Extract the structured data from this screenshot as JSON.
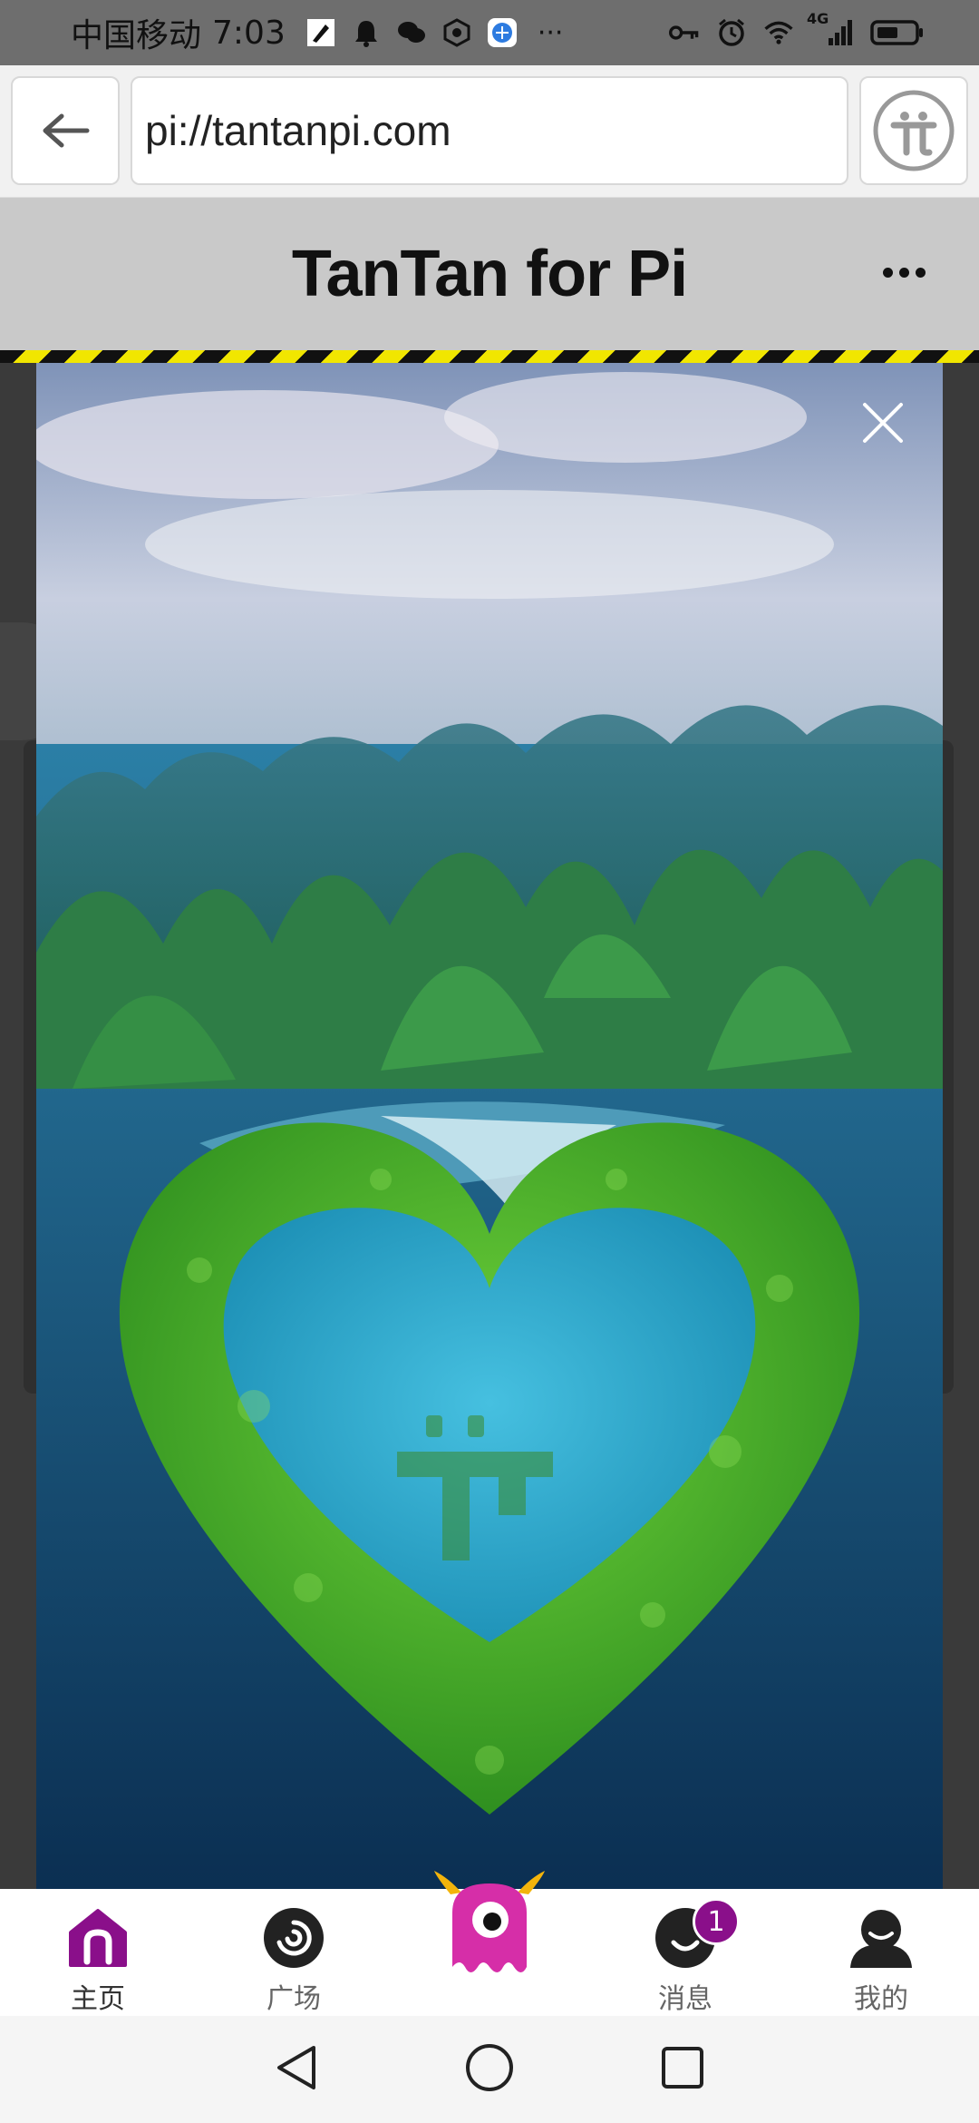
{
  "status_bar": {
    "carrier": "中国移动",
    "time": "7:03",
    "network": "4G",
    "left_icons": [
      "rocket-icon",
      "notification-bell-icon",
      "wechat-icon",
      "app-icon",
      "browser-icon"
    ],
    "right_icons": [
      "key-icon",
      "alarm-icon",
      "wifi-icon",
      "signal-icon",
      "battery-icon"
    ],
    "overflow": "···"
  },
  "browser": {
    "url": "pi://tantanpi.com"
  },
  "app": {
    "title": "TanTan for Pi"
  },
  "bottom_nav": {
    "items": [
      {
        "label": "主页",
        "icon": "home-icon",
        "active": true
      },
      {
        "label": "广场",
        "icon": "plaza-icon",
        "active": false
      },
      {
        "label": "",
        "icon": "mascot-icon",
        "active": false
      },
      {
        "label": "消息",
        "icon": "message-icon",
        "active": false,
        "badge": "1"
      },
      {
        "label": "我的",
        "icon": "profile-icon",
        "active": false
      }
    ]
  },
  "colors": {
    "accent": "#8a0f8a",
    "header_bg": "#c9c9c9",
    "hazard_yellow": "#f1e600"
  }
}
